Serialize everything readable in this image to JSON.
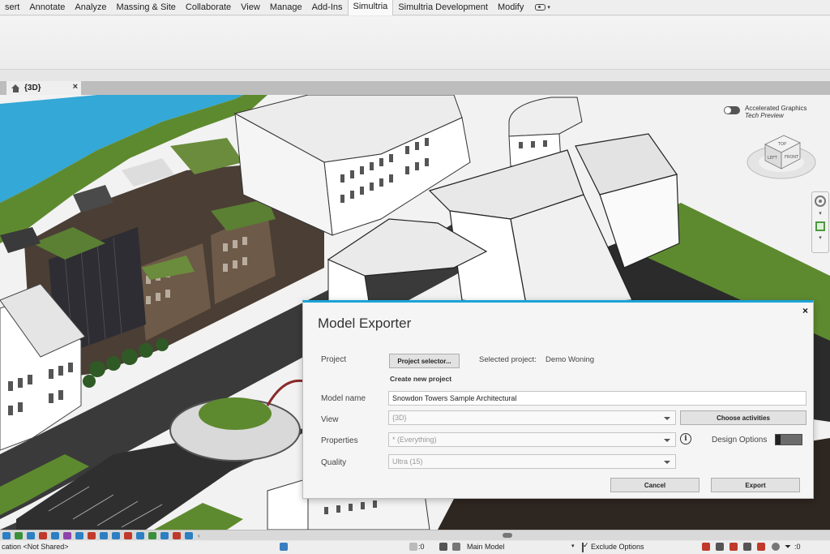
{
  "ribbon": {
    "tabs": [
      "sert",
      "Annotate",
      "Analyze",
      "Massing & Site",
      "Collaborate",
      "View",
      "Manage",
      "Add-Ins",
      "Simultria",
      "Simultria Development",
      "Modify"
    ],
    "active_tab": "Simultria"
  },
  "view_tab": {
    "label": "{3D}"
  },
  "accelerated_graphics": {
    "label": "Accelerated Graphics",
    "sub": "Tech Preview"
  },
  "view_cube": {
    "top": "TOP",
    "left": "LEFT",
    "front": "FRONT"
  },
  "dialog": {
    "title": "Model Exporter",
    "close": "×",
    "project_label": "Project",
    "project_selector": "Project selector...",
    "selected_project_label": "Selected project:",
    "selected_project_value": "Demo Woning",
    "create_new_project": "Create new project",
    "model_name_label": "Model name",
    "model_name_value": "Snowdon Towers Sample Architectural",
    "view_label": "View",
    "view_value": "{3D}",
    "choose_activities": "Choose activities",
    "properties_label": "Properties",
    "properties_value": "* (Everything)",
    "info": "i",
    "design_options_label": "Design Options",
    "quality_label": "Quality",
    "quality_value": "Ultra (15)",
    "cancel": "Cancel",
    "export": "Export"
  },
  "status_bar": {
    "left_text": "cation <Not Shared>",
    "workset_count": ":0",
    "model": "Main Model",
    "exclude_options": "Exclude Options",
    "filter_count": ":0"
  },
  "colors": {
    "accent": "#1aa3d8",
    "water": "#34a8d6",
    "grass": "#5e8a2f",
    "road": "#3a3a3a"
  }
}
